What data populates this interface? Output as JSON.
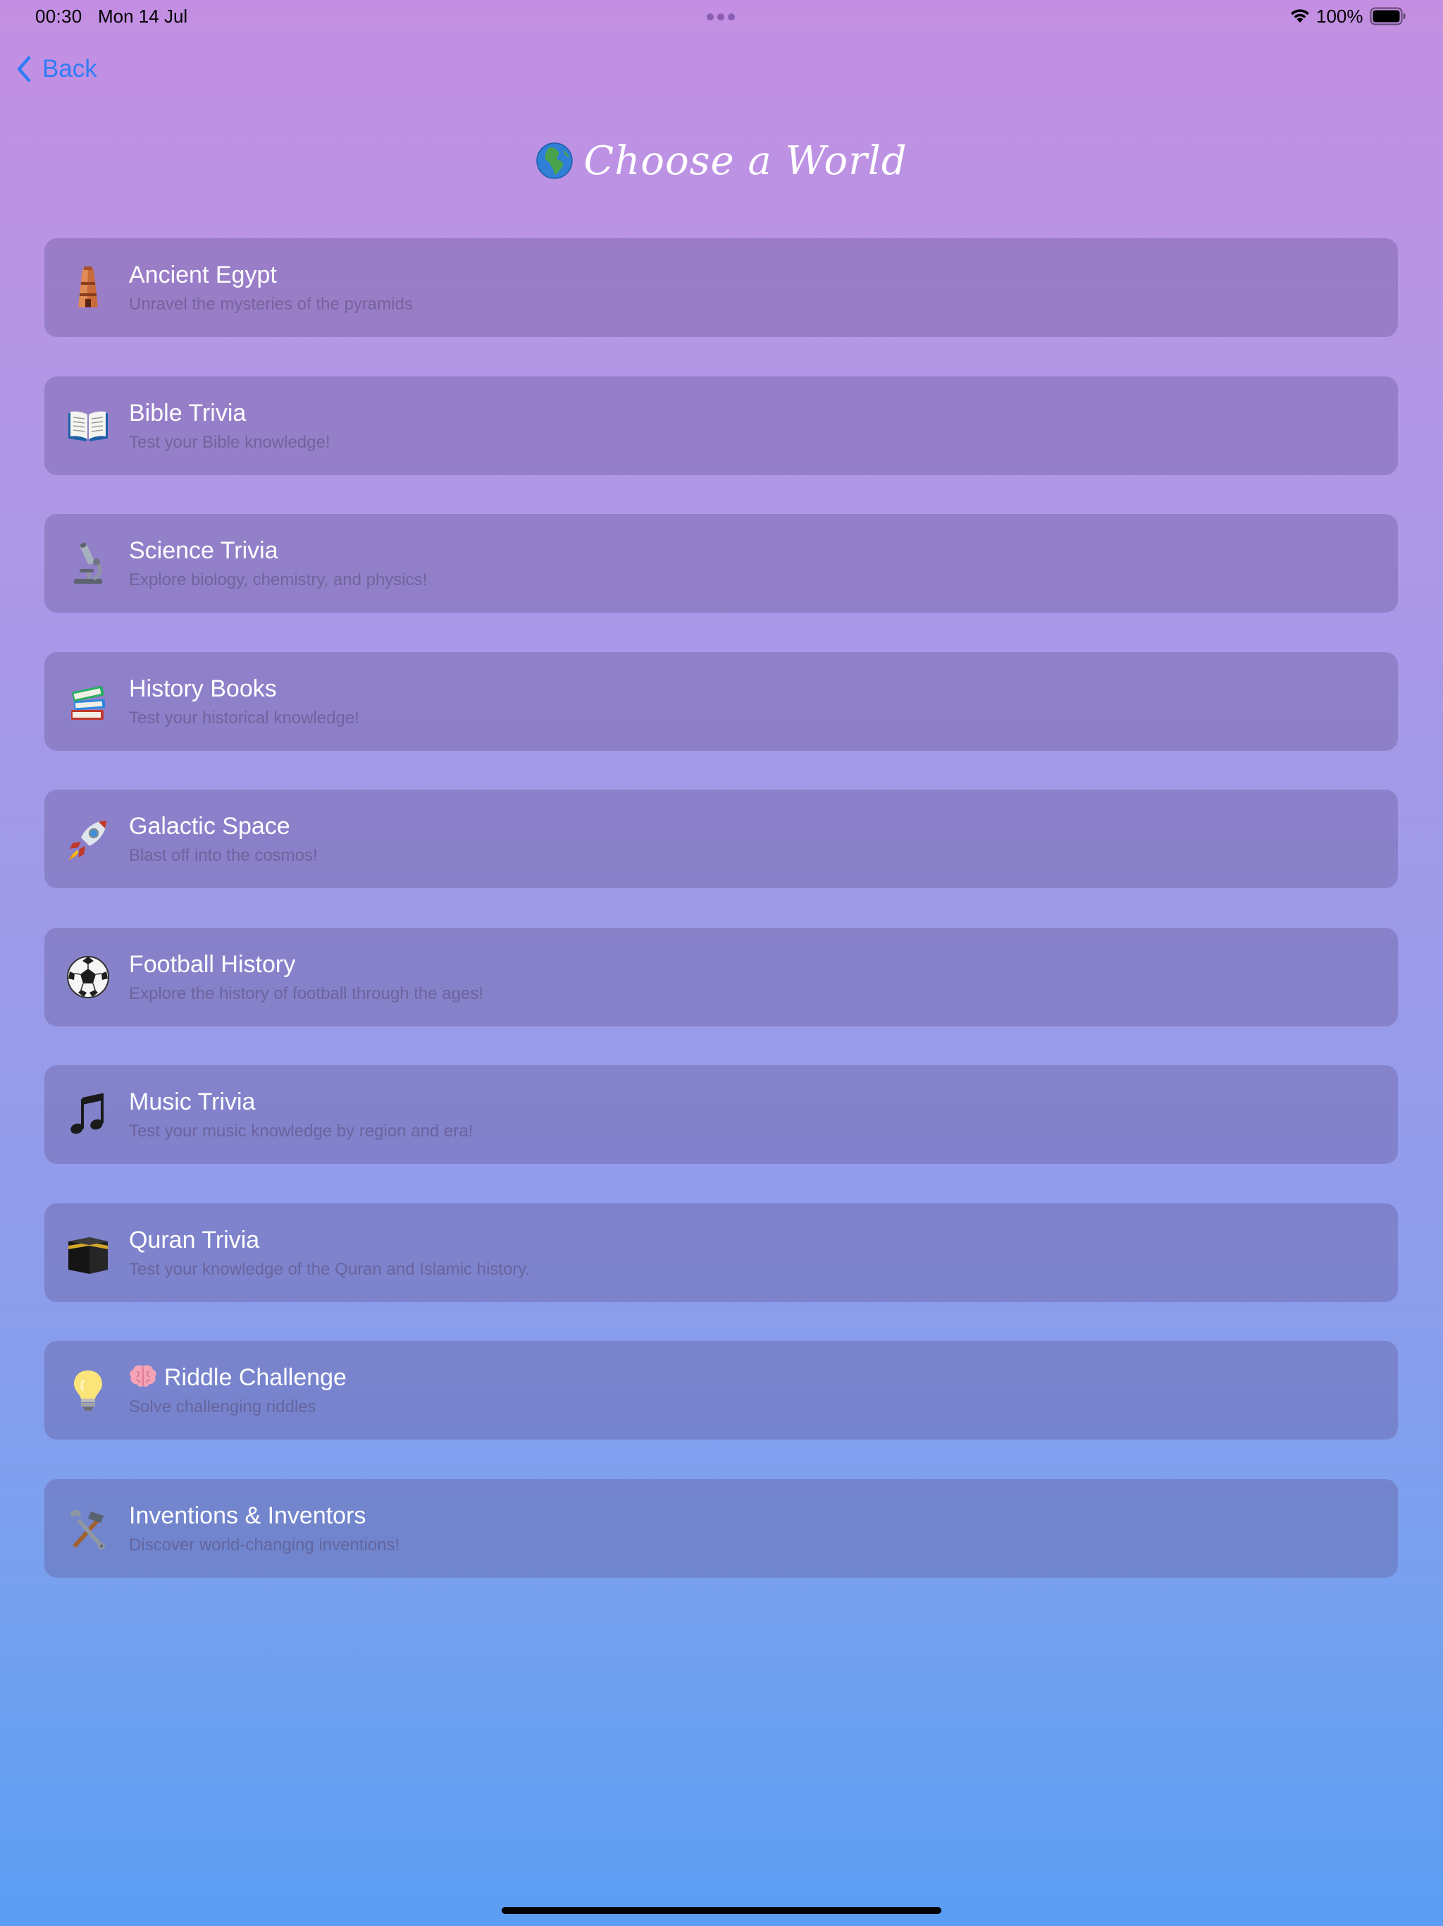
{
  "status_bar": {
    "time": "00:30",
    "date": "Mon 14 Jul",
    "battery": "100%"
  },
  "nav": {
    "back_label": "Back"
  },
  "header": {
    "title": "Choose a World",
    "title_icon": "globe-africa-icon"
  },
  "worlds": [
    {
      "title": "Ancient Egypt",
      "subtitle": "Unravel the mysteries of the pyramids",
      "icon": "temple-icon"
    },
    {
      "title": "Bible Trivia",
      "subtitle": "Test your Bible knowledge!",
      "icon": "open-book-icon"
    },
    {
      "title": "Science Trivia",
      "subtitle": "Explore biology, chemistry, and physics!",
      "icon": "microscope-icon"
    },
    {
      "title": "History Books",
      "subtitle": "Test your historical knowledge!",
      "icon": "books-icon"
    },
    {
      "title": "Galactic Space",
      "subtitle": "Blast off into the cosmos!",
      "icon": "rocket-icon"
    },
    {
      "title": "Football History",
      "subtitle": "Explore the history of football through the ages!",
      "icon": "soccer-ball-icon"
    },
    {
      "title": "Music Trivia",
      "subtitle": "Test your music knowledge by region and era!",
      "icon": "music-note-icon"
    },
    {
      "title": "Quran Trivia",
      "subtitle": "Test your knowledge of the Quran and Islamic history.",
      "icon": "kaaba-icon"
    },
    {
      "title": "Riddle Challenge",
      "subtitle": "Solve challenging riddles",
      "icon": "lightbulb-icon",
      "title_icon": "brain-icon"
    },
    {
      "title": "Inventions & Inventors",
      "subtitle": "Discover world-changing inventions!",
      "icon": "hammer-wrench-icon"
    }
  ],
  "colors": {
    "accent": "#2f7cf6",
    "gradient_top": "#c48fe2",
    "gradient_bottom": "#5a9df3"
  }
}
